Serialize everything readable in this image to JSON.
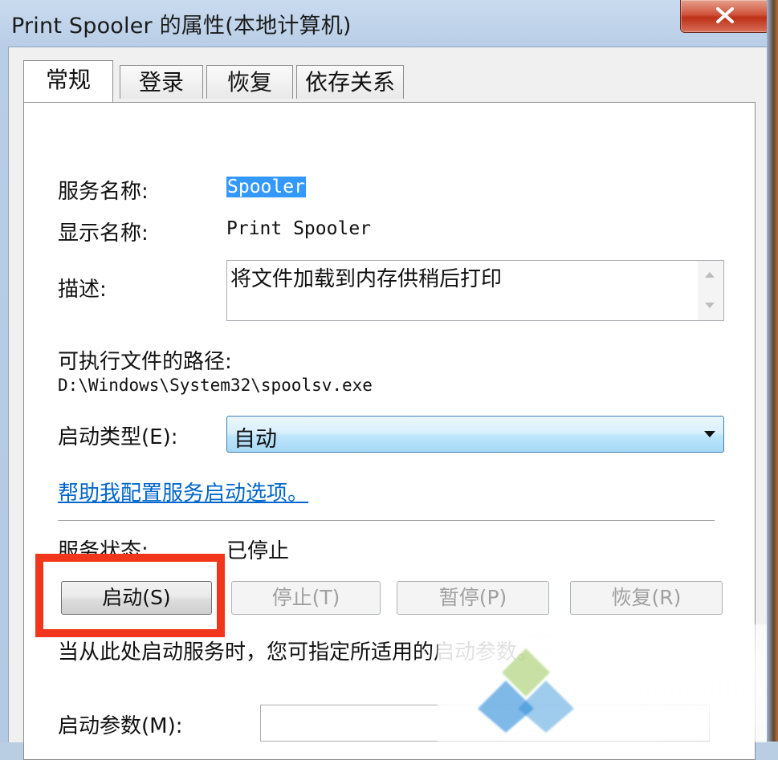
{
  "window": {
    "title": "Print Spooler 的属性(本地计算机)"
  },
  "tabs": [
    {
      "label": "常规",
      "active": true
    },
    {
      "label": "登录",
      "active": false
    },
    {
      "label": "恢复",
      "active": false
    },
    {
      "label": "依存关系",
      "active": false
    }
  ],
  "general": {
    "service_name_label": "服务名称:",
    "service_name_value": "Spooler",
    "display_name_label": "显示名称:",
    "display_name_value": "Print Spooler",
    "description_label": "描述:",
    "description_value": "将文件加载到内存供稍后打印",
    "exe_path_label": "可执行文件的路径:",
    "exe_path_value": "D:\\Windows\\System32\\spoolsv.exe",
    "startup_type_label": "启动类型(E):",
    "startup_type_value": "自动",
    "help_link": "帮助我配置服务启动选项。",
    "status_label": "服务状态:",
    "status_value": "已停止",
    "buttons": {
      "start": "启动(S)",
      "stop": "停止(T)",
      "pause": "暂停(P)",
      "resume": "恢复(R)"
    },
    "hint": "当从此处启动服务时，您可指定所适用的启动参数。",
    "start_params_label": "启动参数(M):",
    "start_params_value": ""
  },
  "colors": {
    "highlight_box": "#f2361c",
    "selection": "#3399ff",
    "link": "#0066cc"
  }
}
